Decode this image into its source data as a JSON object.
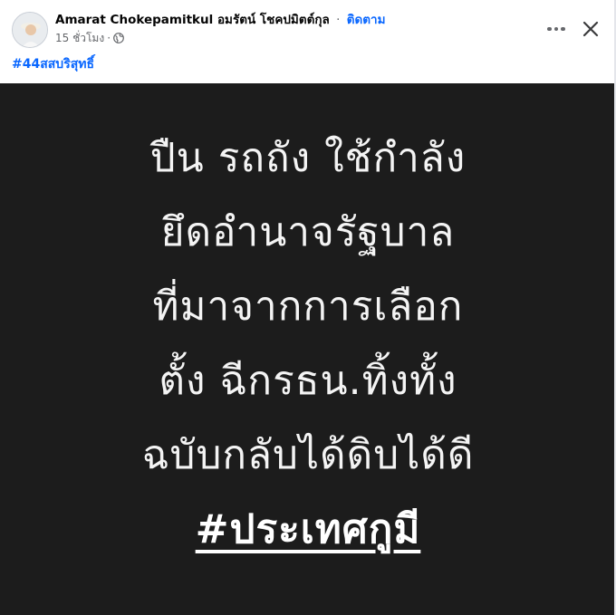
{
  "post": {
    "author": "Amarat Chokepamitkul อมรัตน์ โชคปมิตต์กุล",
    "separator": "·",
    "follow_label": "ติดตาม",
    "timestamp": "15 ชั่วโมง",
    "meta_separator": "·",
    "privacy_icon": "globe-icon",
    "hashtag": "#44สสบริสุทธิ์"
  },
  "image": {
    "lines": [
      "ปืน รถถัง ใช้กำลัง",
      "ยึดอำนาจรัฐบาล",
      "ที่มาจากการเลือก",
      "ตั้ง ฉีกรธน.ทิ้งทั้ง",
      "ฉบับกลับได้ดิบได้ดี"
    ],
    "hashtag": "#ประเทศกูมี"
  },
  "controls": {
    "more_icon": "more-horizontal-icon",
    "close_icon": "close-icon"
  },
  "colors": {
    "link": "#0866ff",
    "meta": "#65676b",
    "image_background": "#1c1c1c",
    "image_text": "#f4f4f4"
  }
}
